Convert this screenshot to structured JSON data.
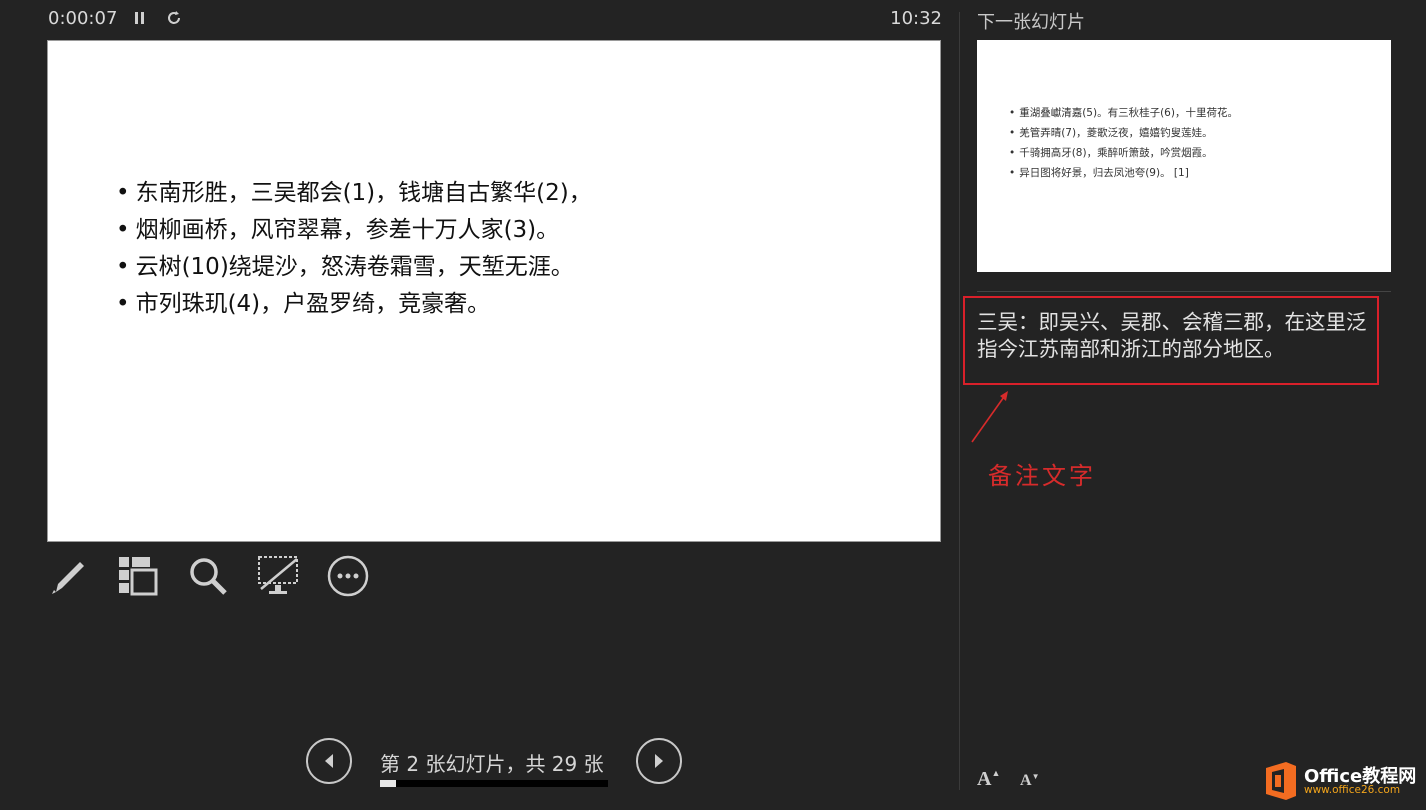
{
  "presenter": {
    "elapsed_time": "0:00:07",
    "clock": "10:32",
    "slide_counter": "第 2 张幻灯片，共 29 张",
    "progress_fraction": 0.069
  },
  "current_slide": {
    "bullets": [
      "东南形胜，三吴都会(1)，钱塘自古繁华(2)，",
      "烟柳画桥，风帘翠幕，参差十万人家(3)。",
      "云树(10)绕堤沙，怒涛卷霜雪，天堑无涯。",
      "市列珠玑(4)，户盈罗绮，竞豪奢。"
    ]
  },
  "next_slide": {
    "title": "下一张幻灯片",
    "bullets": [
      "重湖叠巘清嘉(5)。有三秋桂子(6)，十里荷花。",
      "羌管弄晴(7)，菱歌泛夜，嬉嬉钓叟莲娃。",
      "千骑拥高牙(8)，乘醉听箫鼓，吟赏烟霞。",
      "异日图将好景，归去凤池夸(9)。 [1]"
    ]
  },
  "notes": {
    "text": "三吴：即吴兴、吴郡、会稽三郡，在这里泛指今江苏南部和浙江的部分地区。"
  },
  "annotation": {
    "label": "备注文字",
    "color": "#d62b2b"
  },
  "font_controls": {
    "increase": "A",
    "decrease": "A"
  },
  "watermark": {
    "brand": "Office教程网",
    "url": "www.office26.com"
  },
  "colors": {
    "background": "#232323",
    "highlight_red": "#d9202a",
    "logo_orange": "#f36c21"
  }
}
